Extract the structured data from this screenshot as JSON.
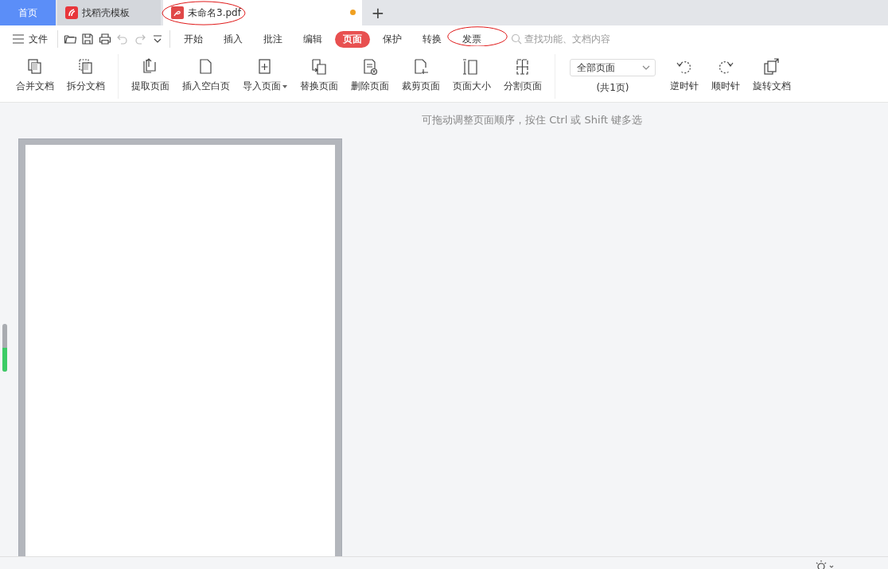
{
  "tabs": [
    {
      "kind": "home",
      "label": "首页",
      "selected": false
    },
    {
      "kind": "template",
      "label": "找稻壳模板",
      "selected": false
    },
    {
      "kind": "doc",
      "label": "未命名3.pdf",
      "selected": true,
      "modified": true,
      "circled": true
    }
  ],
  "new_tab": "+",
  "file_menu": "文件",
  "menu": [
    {
      "label": "开始",
      "selected": false
    },
    {
      "label": "插入",
      "selected": false
    },
    {
      "label": "批注",
      "selected": false
    },
    {
      "label": "编辑",
      "selected": false
    },
    {
      "label": "页面",
      "selected": true
    },
    {
      "label": "保护",
      "selected": false
    },
    {
      "label": "转换",
      "selected": false
    },
    {
      "label": "发票",
      "selected": false,
      "circled": true
    }
  ],
  "search": {
    "placeholder": "查找功能、文档内容"
  },
  "toolbar": [
    {
      "kind": "button",
      "label": "合并文档"
    },
    {
      "kind": "button",
      "label": "拆分文档"
    },
    {
      "kind": "separator"
    },
    {
      "kind": "button",
      "label": "提取页面"
    },
    {
      "kind": "button",
      "label": "插入空白页"
    },
    {
      "kind": "button",
      "label": "导入页面",
      "dropdown": true
    },
    {
      "kind": "button",
      "label": "替换页面"
    },
    {
      "kind": "button",
      "label": "删除页面"
    },
    {
      "kind": "button",
      "label": "裁剪页面"
    },
    {
      "kind": "button",
      "label": "页面大小"
    },
    {
      "kind": "button",
      "label": "分割页面"
    },
    {
      "kind": "separator"
    },
    {
      "kind": "select",
      "value": "全部页面",
      "caption": "(共1页)"
    },
    {
      "kind": "button",
      "label": "逆时针"
    },
    {
      "kind": "button",
      "label": "顺时针"
    },
    {
      "kind": "button",
      "label": "旋转文档"
    }
  ],
  "hint": "可拖动调整页面顺序，按住 Ctrl 或 Shift 键多选",
  "side_slider": {
    "level": 0.5
  }
}
